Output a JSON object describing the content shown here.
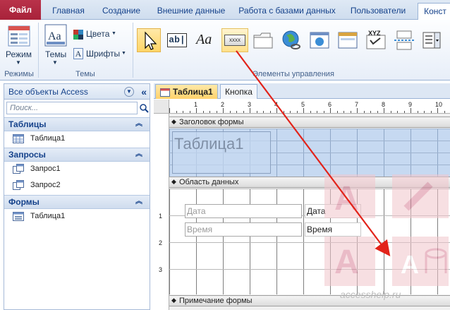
{
  "ribbon_tabs": [
    "Файл",
    "Главная",
    "Создание",
    "Внешние данные",
    "Работа с базами данных",
    "Пользователи",
    "Конст"
  ],
  "ribbon": {
    "mode_label": "Режим",
    "themes_label": "Темы",
    "colors_label": "Цвета",
    "fonts_label": "Шрифты",
    "group_modes": "Режимы",
    "group_themes": "Темы",
    "group_controls": "Элементы управления",
    "ctl_textbox": "ab|",
    "ctl_label": "Aa",
    "ctl_button": "xxxx",
    "ctl_xyz": "XYZ"
  },
  "nav": {
    "title": "Все объекты Access",
    "search_placeholder": "Поиск...",
    "sections": [
      {
        "title": "Таблицы",
        "items": [
          "Таблица1"
        ]
      },
      {
        "title": "Запросы",
        "items": [
          "Запрос1",
          "Запрос2"
        ]
      },
      {
        "title": "Формы",
        "items": [
          "Таблица1"
        ]
      }
    ]
  },
  "doc_tabs": [
    "Таблица1",
    "Кнопка"
  ],
  "form": {
    "header_band": "Заголовок формы",
    "title": "Таблица1",
    "detail_band": "Область данных",
    "footer_band": "Примечание формы",
    "fields": [
      {
        "value": "Дата",
        "label": "Дата"
      },
      {
        "value": "Время",
        "label": "Время"
      }
    ],
    "ruler_numbers": [
      "1",
      "2",
      "3",
      "4",
      "5",
      "6",
      "7",
      "8",
      "9",
      "10"
    ],
    "vruler_numbers": [
      "1",
      "2",
      "3"
    ]
  },
  "watermark": "accesshelp.ru",
  "colors": {
    "accent": "#15428b",
    "file_tab": "#b9324a",
    "arrow": "#e2231a",
    "header_fill": "#c6d9f1"
  }
}
